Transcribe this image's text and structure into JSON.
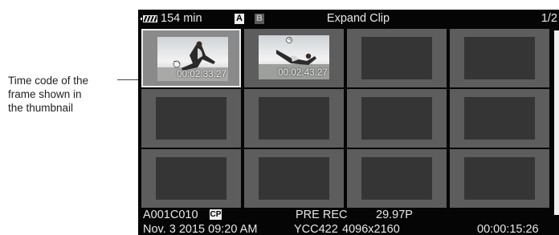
{
  "callout": {
    "lines": [
      "Time code of the",
      "frame shown in",
      "the thumbnail"
    ]
  },
  "header": {
    "battery_icon": "battery-icon",
    "time_remaining": "154 min",
    "slot_a": "A",
    "slot_b": "B",
    "title": "Expand Clip",
    "page": "1/2"
  },
  "thumbnails": [
    {
      "timecode": "00:02:33.27",
      "selected": true
    },
    {
      "timecode": "00:02:43.27",
      "selected": false
    }
  ],
  "footer": {
    "clip_name": "A001C010",
    "cp_badge": "CP",
    "pre_rec": "PRE REC",
    "frame_rate": "29.97P",
    "date": "Nov. 3 2015 09:20 AM",
    "color_format": "YCC422",
    "resolution": "4096x2160",
    "duration": "00:00:15:26"
  },
  "colors": {
    "screen_bg": "#050505",
    "cell": "#5d5d5d",
    "selection": "#ececec"
  }
}
